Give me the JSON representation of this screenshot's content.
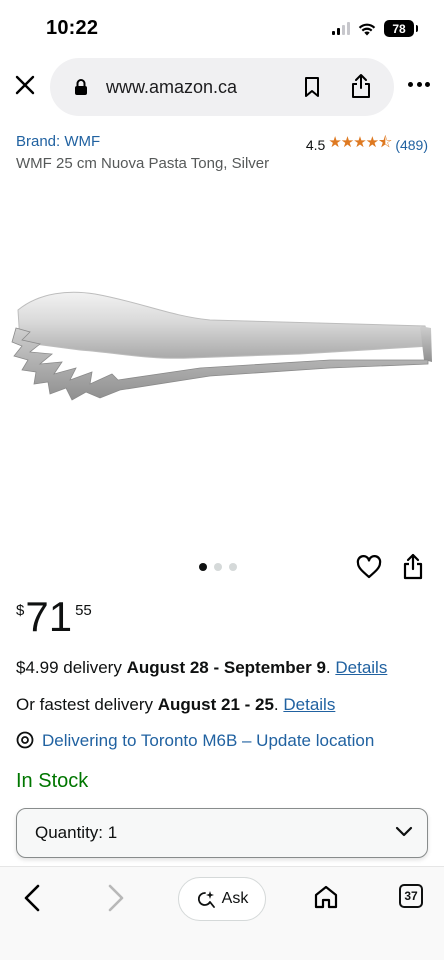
{
  "status_bar": {
    "time": "10:22",
    "battery": "78"
  },
  "browser": {
    "url": "www.amazon.ca"
  },
  "product": {
    "brand": "Brand: WMF",
    "rating_value": "4.5",
    "stars": "★★★★⯪",
    "review_count": "(489)",
    "title": "WMF 25 cm Nuova Pasta Tong, Silver",
    "image_count": 3,
    "active_image_index": 0
  },
  "price": {
    "symbol": "$",
    "whole": "71",
    "fraction": "55"
  },
  "delivery": {
    "standard_prefix": "$4.99 delivery ",
    "standard_dates": "August 28 - September 9",
    "standard_suffix": ". ",
    "details_label": "Details",
    "fastest_prefix": "Or fastest delivery ",
    "fastest_dates": "August 21 - 25",
    "fastest_suffix": ". ",
    "location": "Delivering to Toronto M6B – Update location"
  },
  "stock_status": "In Stock",
  "quantity": {
    "label": "Quantity: 1"
  },
  "toolbar": {
    "ask_label": "Ask",
    "tab_count": "37"
  },
  "colors": {
    "link": "#2162a1",
    "stock": "#007600",
    "stars": "#de7921"
  }
}
